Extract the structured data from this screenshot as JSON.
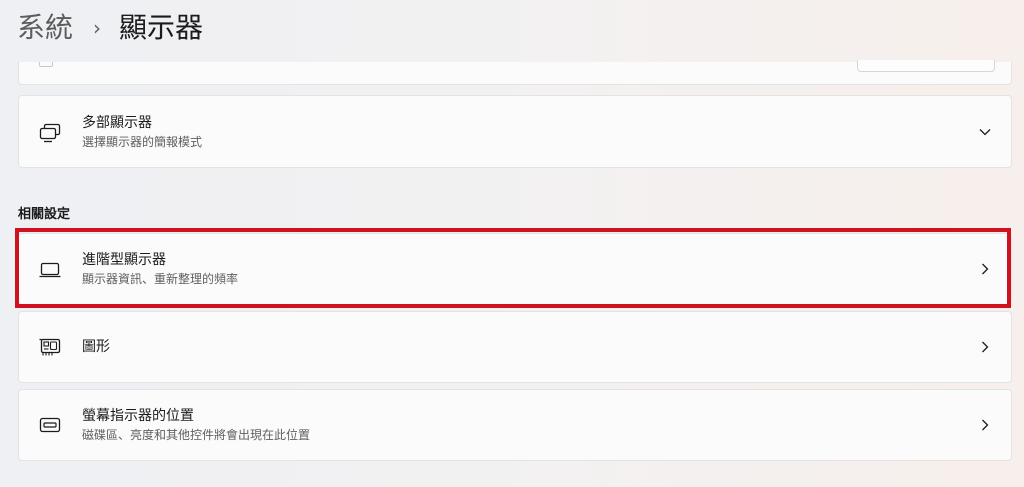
{
  "breadcrumb": {
    "parent": "系統",
    "separator": "›",
    "current": "顯示器"
  },
  "cards": {
    "multi_display": {
      "title": "多部顯示器",
      "subtitle": "選擇顯示器的簡報模式",
      "icon": "multiple-displays-icon",
      "action_icon": "chevron-down-icon"
    },
    "advanced_display": {
      "title": "進階型顯示器",
      "subtitle": "顯示器資訊、重新整理的頻率",
      "icon": "laptop-icon",
      "action_icon": "chevron-right-icon"
    },
    "graphics": {
      "title": "圖形",
      "icon": "graphics-card-icon",
      "action_icon": "chevron-right-icon"
    },
    "pointer_position": {
      "title": "螢幕指示器的位置",
      "subtitle": "磁碟區、亮度和其他控件將會出現在此位置",
      "icon": "display-position-icon",
      "action_icon": "chevron-right-icon"
    }
  },
  "related_settings": {
    "header": "相關設定"
  },
  "colors": {
    "highlight": "#d0121f",
    "card_bg": "#fbfbfb",
    "card_border": "#e3e3e3"
  }
}
